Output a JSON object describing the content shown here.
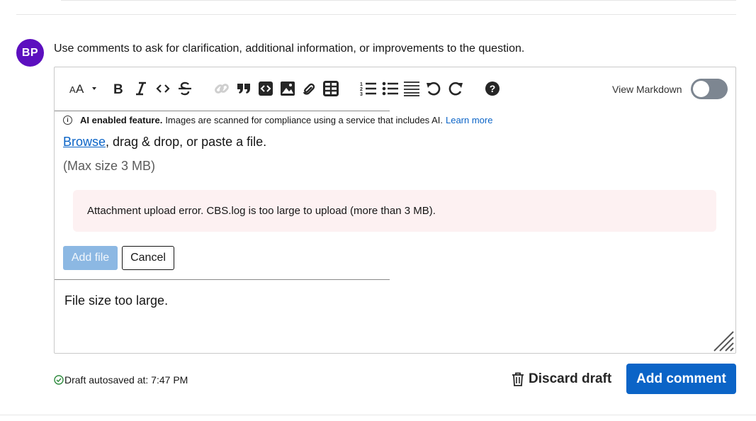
{
  "avatar": {
    "initials": "BP",
    "color": "#5c0fbf"
  },
  "comment_prompt": "Use comments to ask for clarification, additional information, or improvements to the question.",
  "toolbar": {
    "items": [
      {
        "name": "text-size-icon",
        "glyph": "AA"
      },
      {
        "name": "bold-icon",
        "glyph": "B"
      },
      {
        "name": "italic-icon",
        "glyph": "I"
      },
      {
        "name": "code-icon",
        "glyph": "<>"
      },
      {
        "name": "strikethrough-icon",
        "glyph": "S"
      },
      {
        "name": "link-icon",
        "glyph": "link"
      },
      {
        "name": "blockquote-icon",
        "glyph": "quote"
      },
      {
        "name": "code-block-icon",
        "glyph": "code-block"
      },
      {
        "name": "image-icon",
        "glyph": "image"
      },
      {
        "name": "attachment-icon",
        "glyph": "attach"
      },
      {
        "name": "table-icon",
        "glyph": "table"
      },
      {
        "name": "numbered-list-icon",
        "glyph": "ol"
      },
      {
        "name": "bulleted-list-icon",
        "glyph": "ul"
      },
      {
        "name": "horizontal-rule-icon",
        "glyph": "hr"
      },
      {
        "name": "undo-icon",
        "glyph": "undo"
      },
      {
        "name": "redo-icon",
        "glyph": "redo"
      },
      {
        "name": "help-icon",
        "glyph": "?"
      }
    ],
    "view_markdown_label": "View Markdown",
    "view_markdown_on": false
  },
  "upload": {
    "ai_bold": "AI enabled feature.",
    "ai_text": "Images are scanned for compliance using a service that includes AI.",
    "ai_link": "Learn more",
    "browse_link": "Browse",
    "browse_rest": ", drag & drop, or paste a file.",
    "max_size": "(Max size 3 MB)",
    "error": "Attachment upload error. CBS.log is too large to upload (more than 3 MB).",
    "add_file_label": "Add file",
    "cancel_label": "Cancel"
  },
  "textarea_value": "File size too large.",
  "footer": {
    "draft_status": "Draft autosaved at: 7:47 PM",
    "discard_label": "Discard draft",
    "submit_label": "Add comment"
  },
  "colors": {
    "accent": "#0b64c7",
    "error_bg": "#fdf1f2",
    "toggle_off": "#7d8691"
  }
}
